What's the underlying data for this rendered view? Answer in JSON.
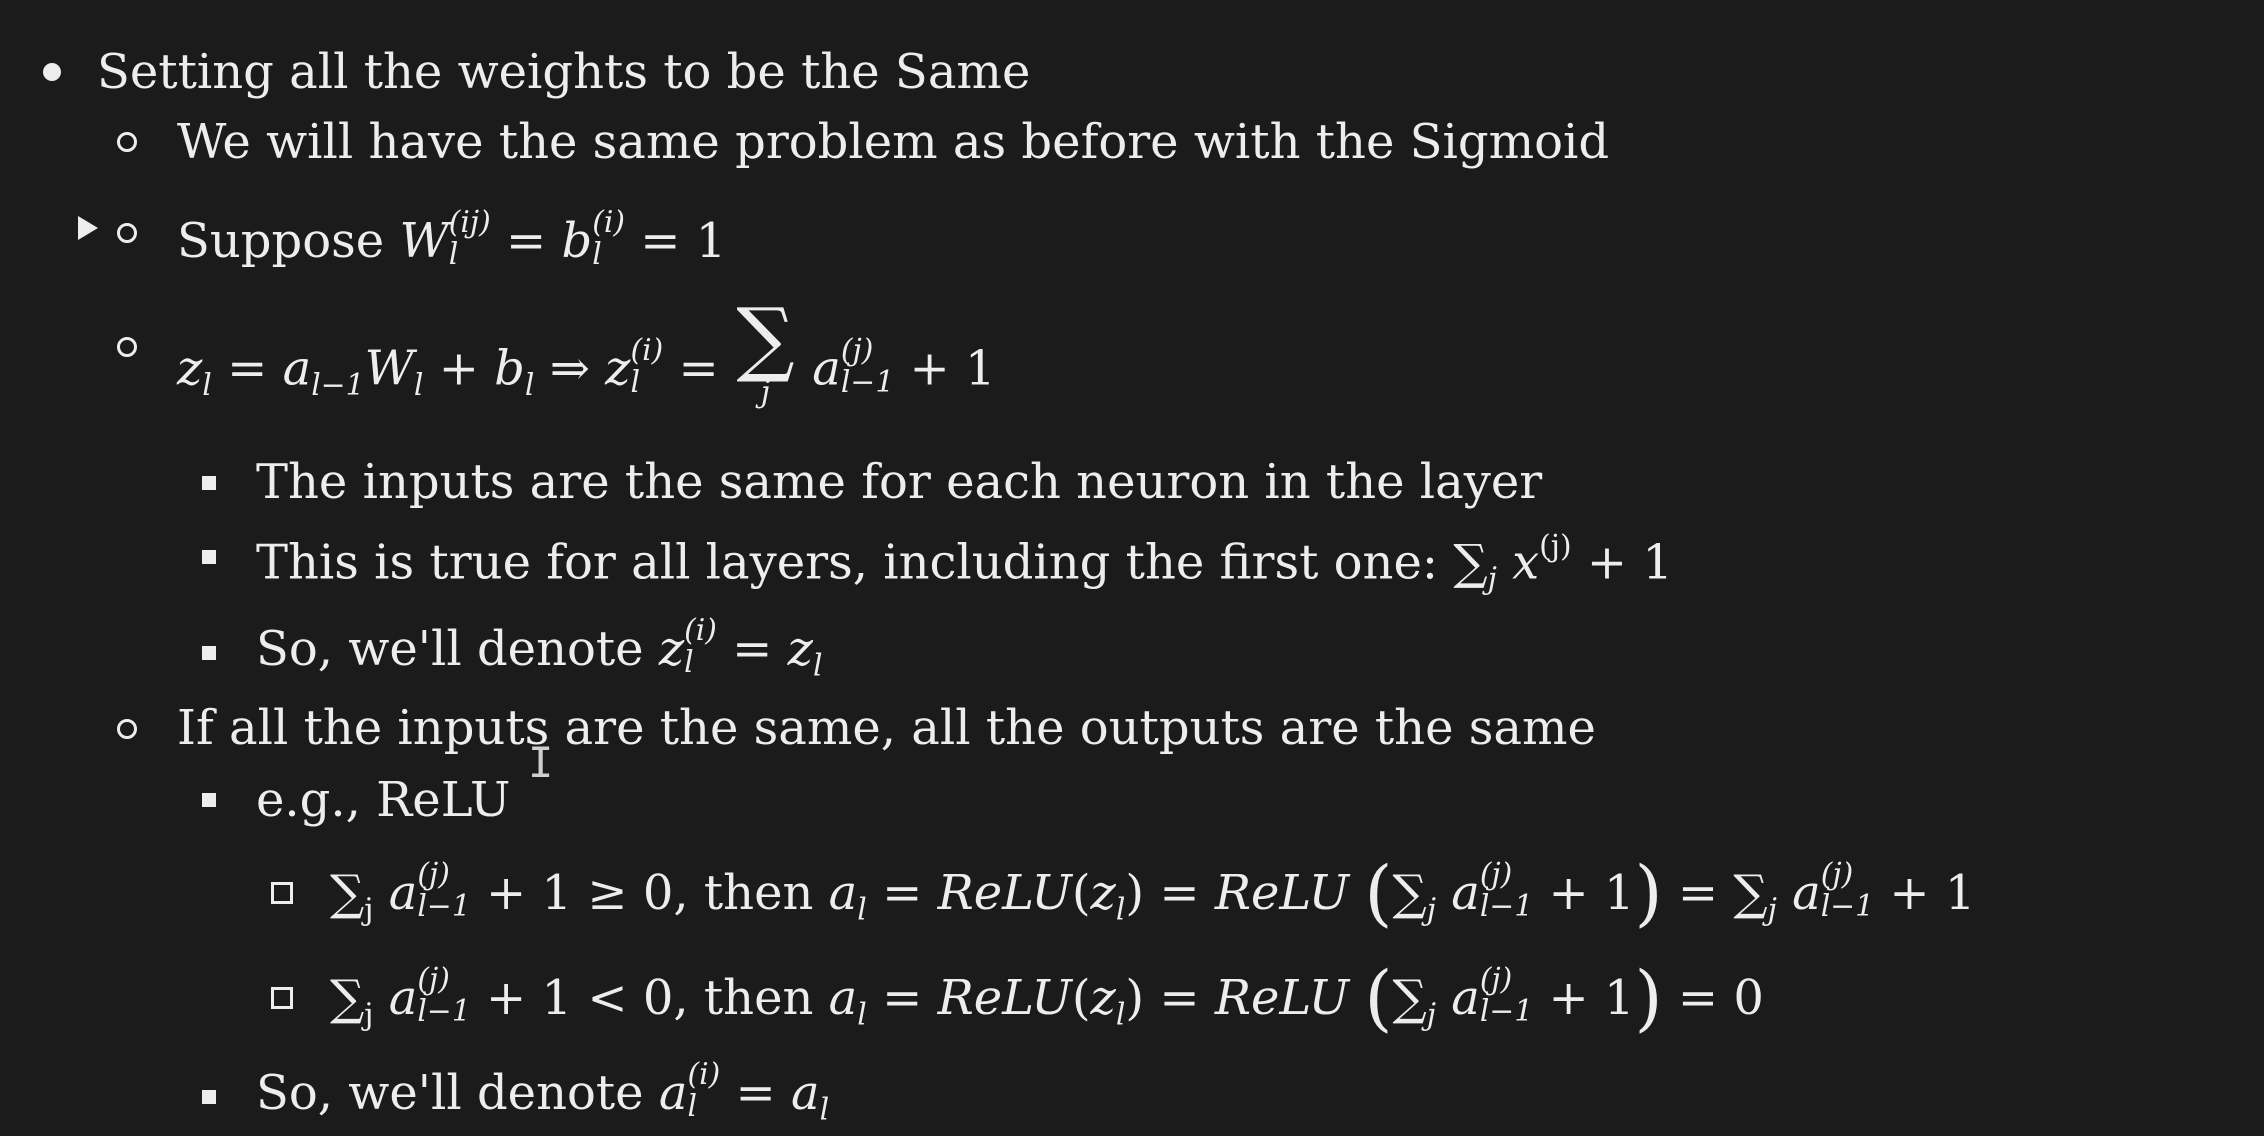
{
  "slide": {
    "line1": "Setting all the weights to be the Same",
    "line2": "We will have the same problem as before with the Sigmoid",
    "line3_prefix": "Suppose",
    "line4_prefix": "",
    "line5": "The inputs are the same for each neuron in the layer",
    "line6_prefix": "This is true for all layers, including the first one:",
    "line7_prefix": "So, we'll denote",
    "line8": "If all the inputs are the same, all the outputs are the same",
    "line9": "e.g., ReLU",
    "line10_then": "then",
    "line11_then": "then",
    "line12_prefix": "So, we'll denote"
  },
  "math": {
    "W": "W",
    "b": "b",
    "l": "l",
    "i_sup": "(i)",
    "ij_sup": "(ij)",
    "j_sup": "(j)",
    "j": "j",
    "eq": "=",
    "one": "1",
    "z": "z",
    "a": "a",
    "lm1": "l−1",
    "plus": "+",
    "implies": "⇒",
    "sum": "∑",
    "x": "x",
    "relu": "ReLU",
    "geq": "≥",
    "lt": "<",
    "zero": "0"
  }
}
